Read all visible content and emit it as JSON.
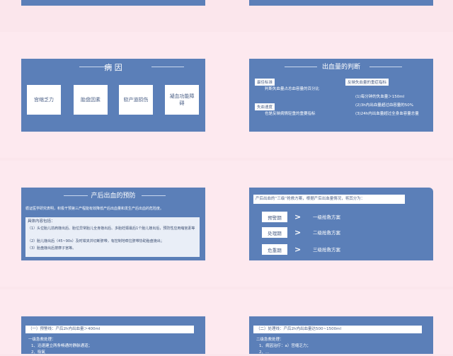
{
  "s1": {
    "title": "病 因",
    "cards": [
      "宫缩乏力",
      "胎盘因素",
      "软产道损伤",
      "凝血功能障碍"
    ]
  },
  "s2": {
    "title": "出血量的判断",
    "left": [
      {
        "tag": "最佳标准",
        "text": "判断失血量占总血容量的百分比"
      },
      {
        "tag": "失血速度",
        "text": "也是反映病情轻重的重要指标"
      }
    ],
    "right": {
      "tag": "反映失血量的重症指标",
      "lines": [
        "(1)每分钟的失血量＞150ml",
        "(2)3h内出血量超过血容量的50%",
        "(3)24h内出血量超过全身血容量总量"
      ]
    }
  },
  "s3": {
    "title": "产后出血的预防",
    "intro": "循证医学研究表明，积极干预第三产程能有效降低产后出血量和发生产后出血的危险度。",
    "box_title": "具体内容包括：",
    "box_lines": [
      "（1）头位胎儿前肩娩出后、胎位异常胎儿全身娩出后、多胎妊娠最后1个胎儿娩出后，预防性应用缩宫素等",
      "（2）胎儿娩出后（45~90s）及时钳夹并切断脐带，有控制地牵拉脐带协助胎盘娩出；",
      "（3）胎盘娩出后按摩子宫等。"
    ]
  },
  "s4": {
    "header": "产后出血的“三级”抢救方案，根据产后出血量情况，将其分为：",
    "rows": [
      {
        "label": "预警期",
        "value": "一级抢救方案"
      },
      {
        "label": "处理期",
        "value": "二级抢救方案"
      },
      {
        "label": "危重期",
        "value": "三级抢救方案"
      }
    ]
  },
  "s5": {
    "banner": "（一）预警线：产后2h内出血量＞400ml",
    "lines": [
      "一级急救处理：",
      "1、迅速建立两条畅通的静脉通道；",
      "2、吸氧"
    ]
  },
  "s6": {
    "banner": "（二）处理线：产后2h内出血量达500~1500ml",
    "lines": [
      "二级急救处理：",
      "1、病因治疗：a）宫缩乏力；",
      "2、..."
    ]
  }
}
